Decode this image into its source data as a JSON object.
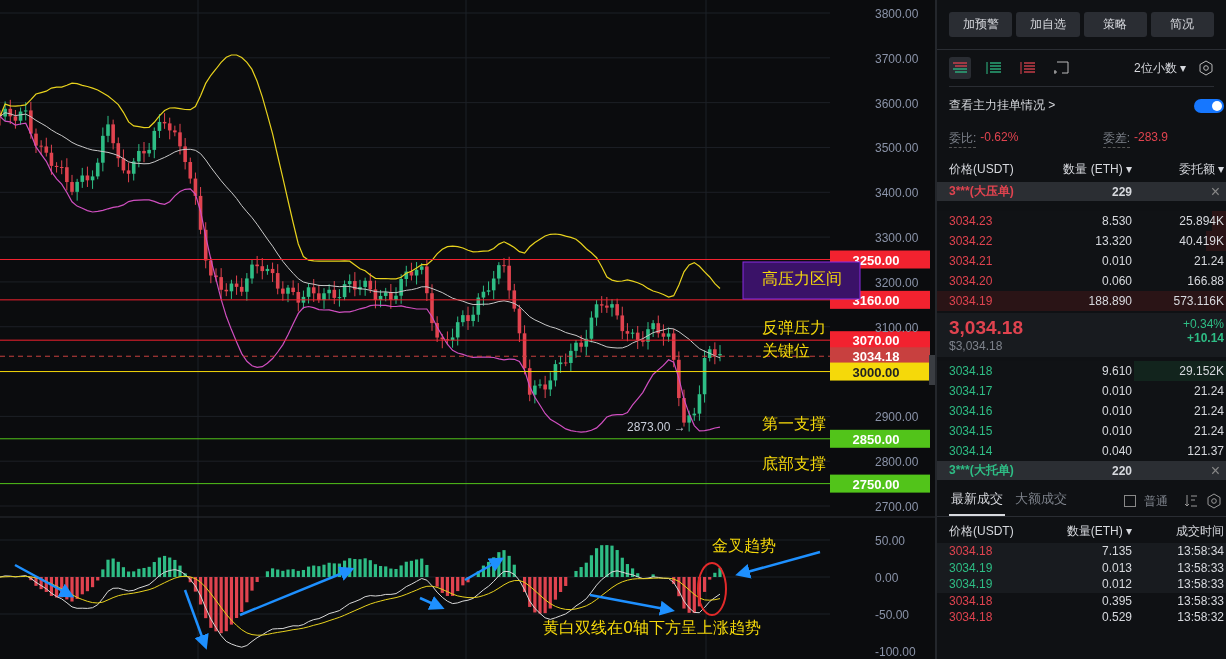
{
  "chart": {
    "price_axis": [
      "3800.00",
      "3700.00",
      "3600.00",
      "3500.00",
      "3400.00",
      "3300.00",
      "3200.00",
      "3100.00",
      "2900.00",
      "2800.00",
      "2700.00"
    ],
    "levels": [
      {
        "label": "3250.00",
        "color": "#f2222f",
        "kind": "line"
      },
      {
        "label": "3160.00",
        "color": "#f2222f",
        "kind": "line"
      },
      {
        "label": "3070.00",
        "color": "#f2222f",
        "kind": "line"
      },
      {
        "label": "3034.18",
        "color": "#c8403f",
        "kind": "current"
      },
      {
        "label": "3000.00",
        "color": "#f5d90a",
        "kind": "line"
      },
      {
        "label": "2850.00",
        "color": "#52c41a",
        "kind": "line"
      },
      {
        "label": "2750.00",
        "color": "#52c41a",
        "kind": "line"
      }
    ],
    "notes": [
      {
        "text": "高压力区间",
        "kind": "zone"
      },
      {
        "text": "反弹压力",
        "kind": "plain"
      },
      {
        "text": "关键位",
        "kind": "plain"
      },
      {
        "text": "第一支撑",
        "kind": "plain"
      },
      {
        "text": "底部支撑",
        "kind": "plain"
      }
    ],
    "low_marker": "2873.00 →",
    "macd_axis": [
      "50.00",
      "0.00",
      "-50.00",
      "-100.00"
    ],
    "macd_notes": [
      "金叉趋势",
      "黄白双线在0轴下方呈上涨趋势"
    ]
  },
  "panel": {
    "buttons": [
      "加预警",
      "加自选",
      "策略",
      "简况"
    ],
    "tools": [
      {
        "kind": "both",
        "selected": true
      },
      {
        "kind": "bids",
        "selected": false
      },
      {
        "kind": "asks",
        "selected": false
      },
      {
        "kind": "custom",
        "selected": false
      }
    ],
    "decimals": "2位小数 ▾",
    "whale_link": "查看主力挂单情况 >",
    "whale_toggle_on": true,
    "ratio_label": "委比:",
    "ratio": "-0.62%",
    "diff_label": "委差:",
    "diff": "-283.9",
    "book_columns": [
      "价格(USDT)",
      "数量 (ETH) ▾",
      "委托额 ▾"
    ],
    "ask_banner": {
      "label": "3***(大压单)",
      "qty": "229",
      "close": "×"
    },
    "asks": [
      {
        "price": "3034.23",
        "qty": "8.530",
        "total": "25.894K",
        "level": 0.05
      },
      {
        "price": "3034.22",
        "qty": "13.320",
        "total": "40.419K",
        "level": 0.07
      },
      {
        "price": "3034.21",
        "qty": "0.010",
        "total": "21.24"
      },
      {
        "price": "3034.20",
        "qty": "0.060",
        "total": "166.88"
      },
      {
        "price": "3034.19",
        "qty": "188.890",
        "total": "573.116K",
        "level": 1
      }
    ],
    "last_price": "3,034.18",
    "last_usd": "$3,034.18",
    "change_pct": "+0.34%",
    "change": "+10.14",
    "bids": [
      {
        "price": "3034.18",
        "qty": "9.610",
        "total": "29.152K",
        "level": 0.32
      },
      {
        "price": "3034.17",
        "qty": "0.010",
        "total": "21.24"
      },
      {
        "price": "3034.16",
        "qty": "0.010",
        "total": "21.24"
      },
      {
        "price": "3034.15",
        "qty": "0.010",
        "total": "21.24"
      },
      {
        "price": "3034.14",
        "qty": "0.040",
        "total": "121.37"
      }
    ],
    "bid_banner": {
      "label": "3***(大托单)",
      "qty": "220",
      "close": "×"
    },
    "trade_tabs": [
      {
        "label": "最新成交",
        "selected": true
      },
      {
        "label": "大额成交",
        "selected": false
      }
    ],
    "normal_filter": {
      "label": "普通",
      "checked": false
    },
    "trade_columns": [
      "价格(USDT)",
      "数量(ETH) ▾",
      "成交时间"
    ],
    "trades": [
      {
        "price": "3034.18",
        "qty": "7.135",
        "time": "13:58:34",
        "kind": "sell"
      },
      {
        "price": "3034.19",
        "qty": "0.013",
        "time": "13:58:33",
        "kind": "buy"
      },
      {
        "price": "3034.19",
        "qty": "0.012",
        "time": "13:58:33",
        "kind": "buy"
      },
      {
        "price": "3034.18",
        "qty": "0.395",
        "time": "13:58:33",
        "kind": "sell"
      },
      {
        "price": "3034.18",
        "qty": "0.529",
        "time": "13:58:32",
        "kind": "sell"
      }
    ]
  }
}
